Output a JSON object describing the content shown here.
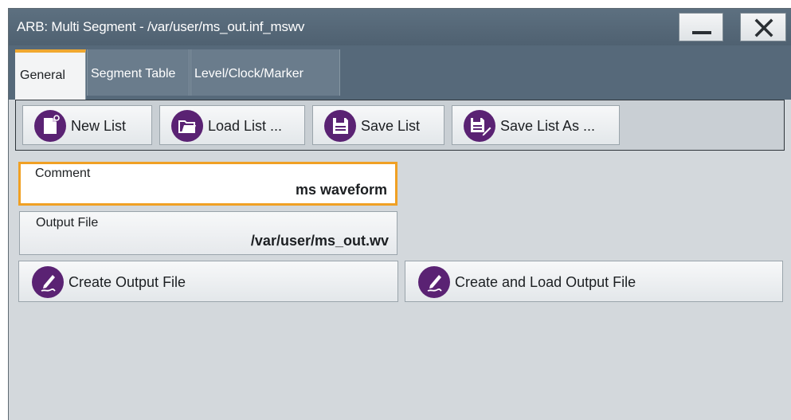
{
  "window": {
    "title": "ARB: Multi Segment - /var/user/ms_out.inf_mswv",
    "minimize_icon": "minimize-icon",
    "close_icon": "close-icon"
  },
  "tabs": [
    {
      "label": "General",
      "active": true
    },
    {
      "label": "Segment Table",
      "active": false
    },
    {
      "label": "Level/Clock/Marker",
      "active": false
    }
  ],
  "toolbar": {
    "new_list": {
      "label": "New List",
      "icon": "new-file-icon"
    },
    "load_list": {
      "label": "Load List ...",
      "icon": "open-folder-icon"
    },
    "save_list": {
      "label": "Save List",
      "icon": "save-icon"
    },
    "save_list_as": {
      "label": "Save List As ...",
      "icon": "save-as-icon"
    }
  },
  "fields": {
    "comment": {
      "label": "Comment",
      "value": "ms waveform"
    },
    "output_file": {
      "label": "Output File",
      "value": "/var/user/ms_out.wv"
    }
  },
  "actions": {
    "create_output": {
      "label": "Create Output File",
      "icon": "pen-icon"
    },
    "create_and_load": {
      "label": "Create and Load Output File",
      "icon": "pen-icon"
    }
  },
  "colors": {
    "accent": "#f0a024",
    "icon_purple": "#5a2273",
    "titlebar": "#56697a"
  }
}
